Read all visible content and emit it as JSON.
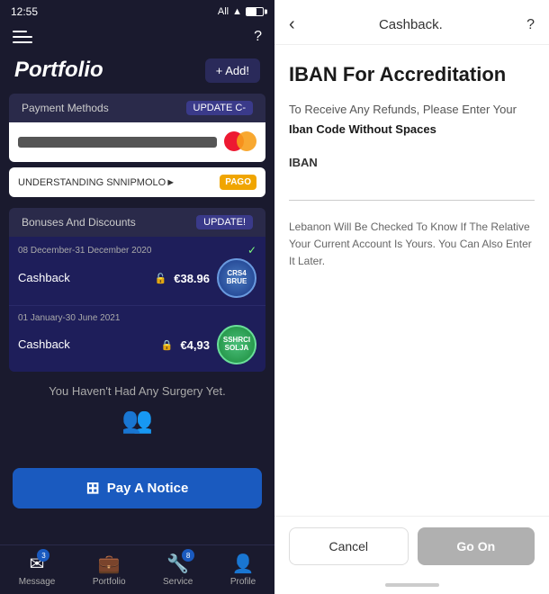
{
  "left": {
    "status": {
      "time": "12:55",
      "network": "All",
      "signal": "▲"
    },
    "portfolio_title": "Portfolio",
    "add_button": "+ Add!",
    "payment_methods": {
      "label": "Payment Methods",
      "update_btn": "UPDATE C-",
      "card_last4": "••••••••••••",
      "pago_text": "UNDERSTANDING SNNIPMOLO►",
      "pago_logo": "PAGO"
    },
    "bonuses": {
      "label": "Bonuses And Discounts",
      "update_btn": "UPDATE!",
      "items": [
        {
          "date": "08 December-31 December 2020",
          "label": "Cashback",
          "amount": "€38.96",
          "locked": false,
          "checked": true,
          "badge": "CRS4\nBRUE"
        },
        {
          "date": "01 January-30 June 2021",
          "label": "Cashback",
          "amount": "€4,93",
          "locked": true,
          "checked": false,
          "badge": "SSHRCI\nSOLJA"
        }
      ]
    },
    "no_surgery": "You Haven't Had Any Surgery Yet.",
    "pay_notice_btn": "Pay A Notice",
    "bottom_nav": {
      "items": [
        {
          "label": "Message",
          "icon": "✉",
          "badge": "3"
        },
        {
          "label": "Portfolio",
          "icon": "💼",
          "badge": null
        },
        {
          "label": "Service",
          "icon": "🔧",
          "badge": "8"
        },
        {
          "label": "Profile",
          "icon": "👤",
          "badge": null
        }
      ]
    }
  },
  "right": {
    "header": {
      "back": "‹",
      "title": "Cashback.",
      "help": "?"
    },
    "heading": "IBAN For Accreditation",
    "instruction": "To Receive Any Refunds, Please Enter Your",
    "instruction2": "Iban Code Without Spaces",
    "iban_label": "IBAN",
    "iban_placeholder": "",
    "note": "Lebanon Will Be Checked To Know If The Relative Your Current Account Is Yours. You Can Also Enter It Later.",
    "cancel_label": "Cancel",
    "go_on_label": "Go On"
  }
}
